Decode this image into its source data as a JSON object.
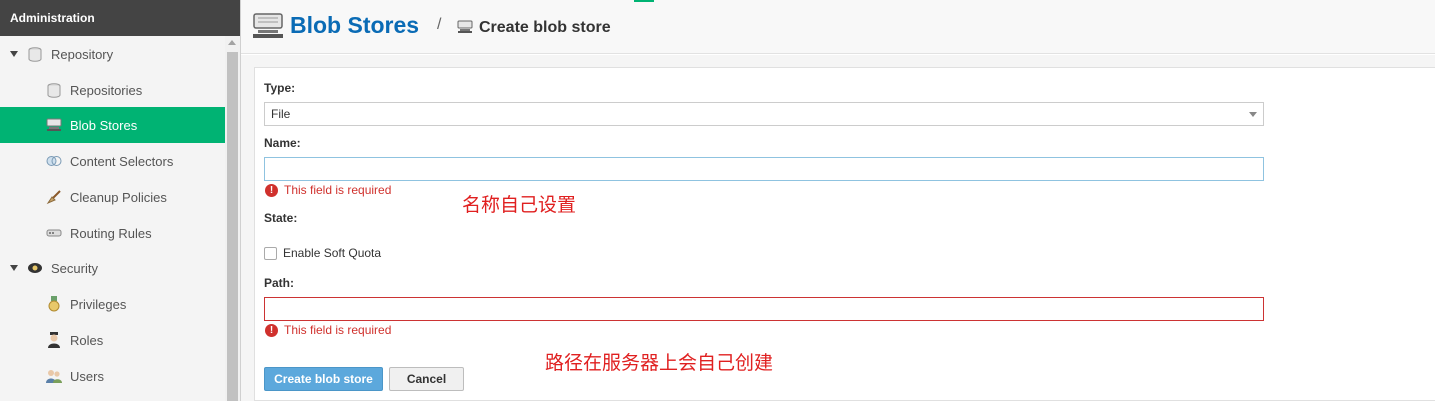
{
  "sidebar": {
    "header": "Administration",
    "items": [
      {
        "label": "Repository",
        "icon": "database-icon",
        "level": 0,
        "expanded": true
      },
      {
        "label": "Repositories",
        "icon": "database-icon",
        "level": 1
      },
      {
        "label": "Blob Stores",
        "icon": "blob-store-icon",
        "level": 1,
        "selected": true
      },
      {
        "label": "Content Selectors",
        "icon": "content-selector-icon",
        "level": 1
      },
      {
        "label": "Cleanup Policies",
        "icon": "broom-icon",
        "level": 1
      },
      {
        "label": "Routing Rules",
        "icon": "router-icon",
        "level": 1
      },
      {
        "label": "Security",
        "icon": "badge-icon",
        "level": 0,
        "expanded": true
      },
      {
        "label": "Privileges",
        "icon": "medal-icon",
        "level": 1
      },
      {
        "label": "Roles",
        "icon": "role-icon",
        "level": 1
      },
      {
        "label": "Users",
        "icon": "users-icon",
        "level": 1
      }
    ]
  },
  "header": {
    "title": "Blob Stores",
    "separator": "/",
    "subtitle": "Create blob store"
  },
  "form": {
    "type_label": "Type:",
    "type_value": "File",
    "name_label": "Name:",
    "name_value": "",
    "name_error": "This field is required",
    "state_label": "State:",
    "soft_quota_label": "Enable Soft Quota",
    "soft_quota_checked": false,
    "path_label": "Path:",
    "path_value": "",
    "path_error": "This field is required",
    "submit_label": "Create blob store",
    "cancel_label": "Cancel"
  },
  "annotations": {
    "name_note": "名称自己设置",
    "path_note": "路径在服务器上会自己创建"
  },
  "colors": {
    "accent": "#00b373",
    "link": "#0a6bb5",
    "error": "#d0312d",
    "primary_button": "#5ca8dc"
  }
}
